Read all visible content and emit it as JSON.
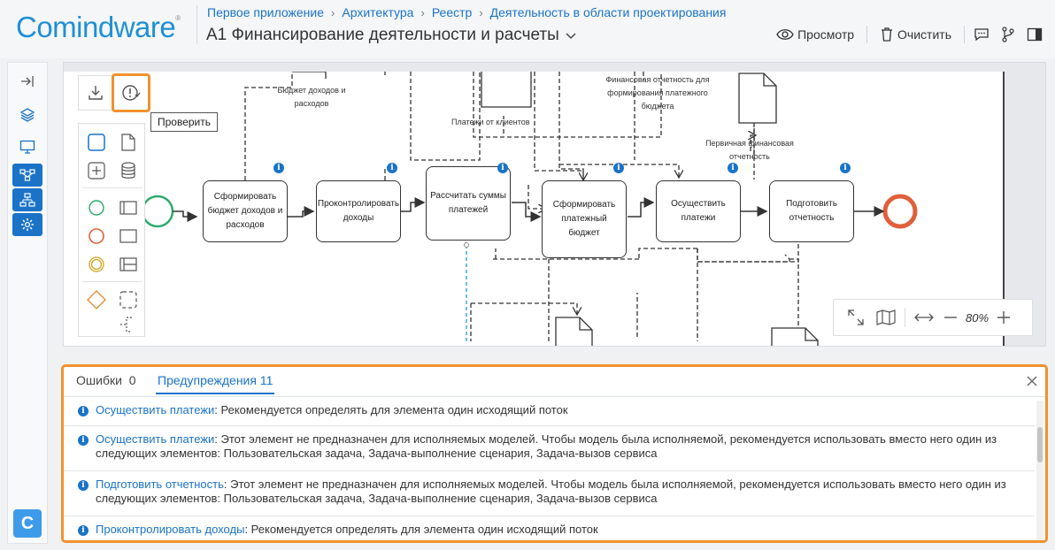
{
  "app": {
    "logo": "Comindware",
    "logo_mark": "®"
  },
  "breadcrumb": [
    "Первое приложение",
    "Архитектура",
    "Реестр",
    "Деятельность в области проектирования"
  ],
  "page_title": "А1 Финансирование деятельности и расчеты",
  "toolbar": {
    "view_label": "Просмотр",
    "clear_label": "Очистить"
  },
  "rail": {
    "app_badge": "C"
  },
  "canvas": {
    "tooltip": "Проверить",
    "zoom": "80%",
    "tasks": [
      {
        "id": "t1",
        "label": "Сформировать бюджет доходов и расходов"
      },
      {
        "id": "t2",
        "label": "Проконтролировать доходы"
      },
      {
        "id": "t3",
        "label": "Рассчитать суммы платежей"
      },
      {
        "id": "t4",
        "label": "Сформировать платежный бюджет"
      },
      {
        "id": "t5",
        "label": "Осуществить платежи"
      },
      {
        "id": "t6",
        "label": "Подготовить отчетность"
      }
    ],
    "labels": {
      "budget": "Бюджет доходов и расходов",
      "payments_clients": "Платежи от клиентов",
      "fin_report": "Финансовая отчетность для формирования платежного бюджета",
      "primary_report": "Первичная финансовая отчетность"
    }
  },
  "issues": {
    "tabs": [
      {
        "label": "Ошибки",
        "count": "0"
      },
      {
        "label": "Предупреждения",
        "count": "11"
      }
    ],
    "items": [
      {
        "link": "Осуществить платежи",
        "text": ": Рекомендуется определять для элемента один исходящий поток"
      },
      {
        "link": "Осуществить платежи",
        "text": ": Этот элемент не предназначен для исполняемых моделей. Чтобы модель была исполняемой, рекомендуется использовать вместо него один из следующих элементов: Пользовательская задача, Задача-выполнение сценария, Задача-вызов сервиса"
      },
      {
        "link": "Подготовить отчетность",
        "text": ": Этот элемент не предназначен для исполняемых моделей. Чтобы модель была исполняемой, рекомендуется использовать вместо него один из следующих элементов: Пользовательская задача, Задача-выполнение сценария, Задача-вызов сервиса"
      },
      {
        "link": "Проконтролировать доходы",
        "text": ": Рекомендуется определять для элемента один исходящий поток"
      }
    ]
  },
  "colors": {
    "accent": "#1a73c7",
    "highlight": "#f0922e",
    "start_event": "#2eaa6b",
    "end_event": "#e0603a"
  }
}
